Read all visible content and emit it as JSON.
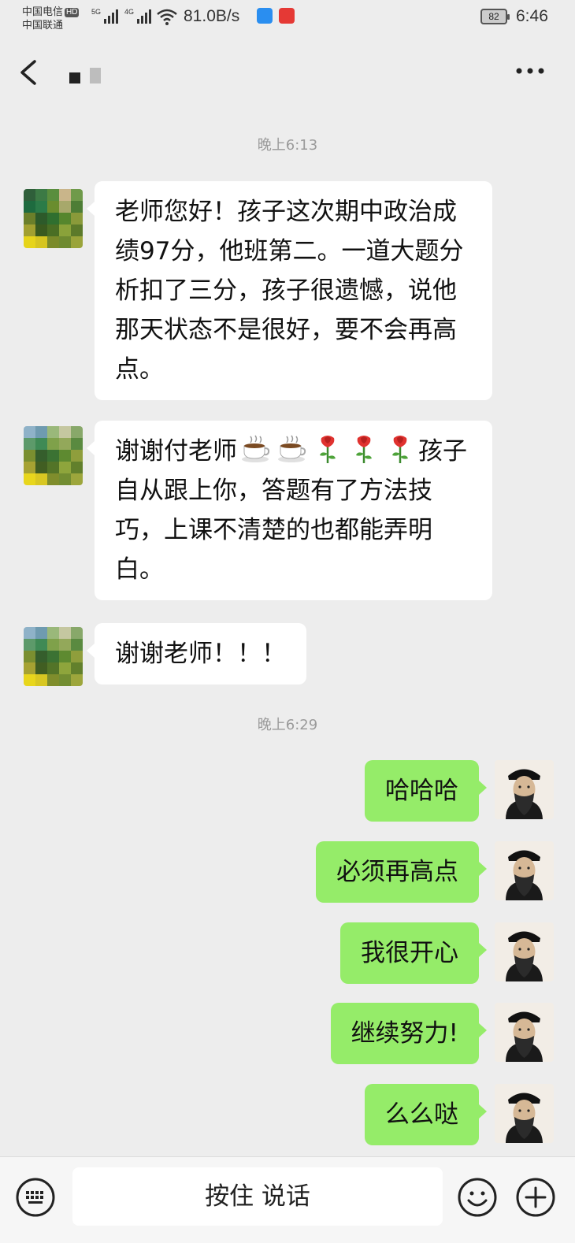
{
  "status_bar": {
    "carrier1": "中国电信",
    "carrier1_badge": "HD",
    "carrier2": "中国联通",
    "signal1": "5G",
    "signal2": "4G",
    "net_speed": "81.0B/s",
    "battery": "82",
    "time": "6:46"
  },
  "header": {
    "back_icon": "back-arrow-icon",
    "more_icon": "more-dots-icon"
  },
  "messages": {
    "timestamp1": "晚上6:13",
    "msg1": "老师您好！孩子这次期中政治成绩97分，他班第二。一道大题分析扣了三分，孩子很遗憾，说他那天状态不是很好，要不会再高点。",
    "msg2_prefix": "谢谢付老师",
    "msg2_emojis": [
      "coffee-emoji",
      "coffee-emoji",
      "rose-emoji",
      "rose-emoji",
      "rose-emoji"
    ],
    "msg2_suffix": "孩子自从跟上你，答题有了方法技巧，上课不清楚的也都能弄明白。",
    "msg3": "谢谢老师！！！",
    "timestamp2": "晚上6:29",
    "out1": "哈哈哈",
    "out2": "必须再高点",
    "out3": "我很开心",
    "out4": "继续努力!",
    "out5": "么么哒"
  },
  "input_bar": {
    "voice_button": "按住 说话",
    "keyboard_icon": "keyboard-icon",
    "emoji_icon": "smiley-icon",
    "plus_icon": "plus-icon"
  },
  "colors": {
    "background": "#ededed",
    "outgoing_bubble": "#95ec69",
    "incoming_bubble": "#ffffff"
  }
}
